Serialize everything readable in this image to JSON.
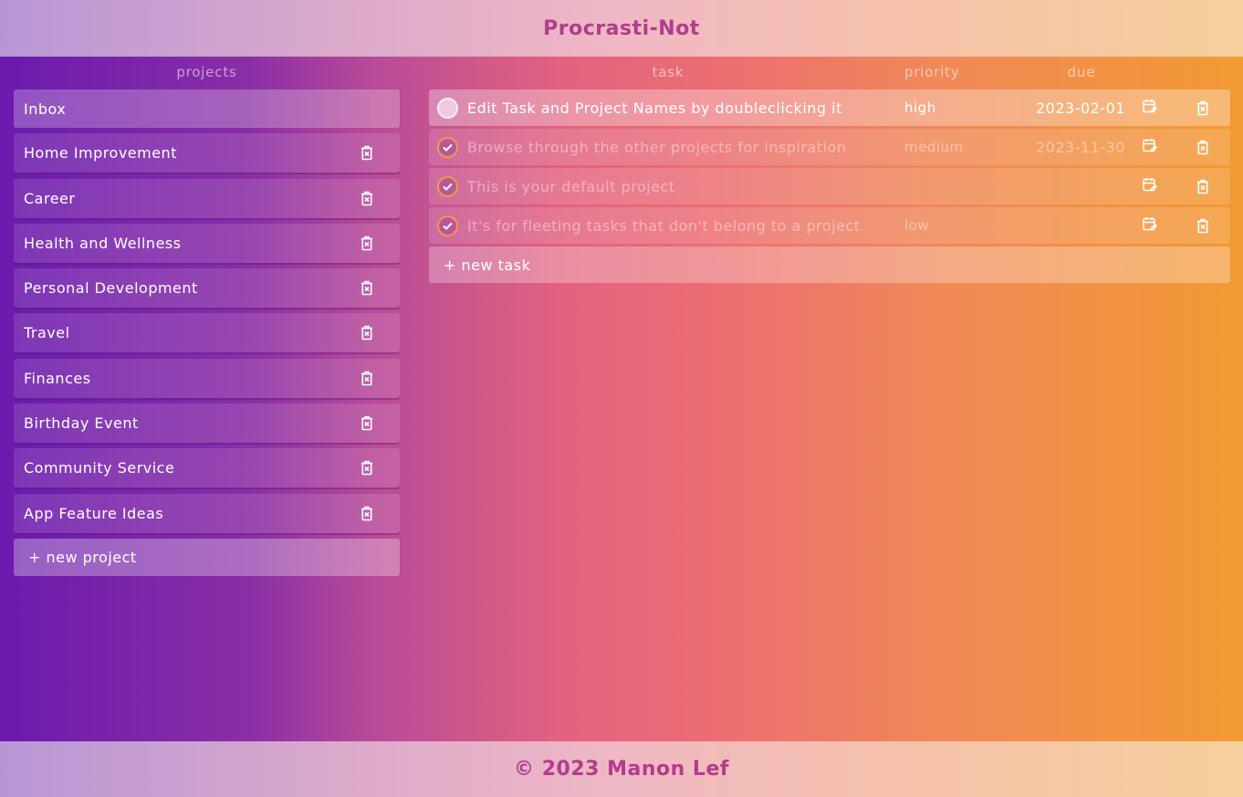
{
  "app": {
    "title": "Procrasti-Not",
    "footer": "© 2023 Manon Lef"
  },
  "columns": {
    "projects": "projects",
    "task": "task",
    "priority": "priority",
    "due": "due"
  },
  "projects": [
    {
      "name": "Inbox",
      "active": true
    },
    {
      "name": "Home Improvement"
    },
    {
      "name": "Career"
    },
    {
      "name": "Health and Wellness"
    },
    {
      "name": "Personal Development"
    },
    {
      "name": "Travel"
    },
    {
      "name": "Finances"
    },
    {
      "name": "Birthday Event"
    },
    {
      "name": "Community Service"
    },
    {
      "name": "App Feature Ideas"
    }
  ],
  "new_project_label": "+ new project",
  "tasks": [
    {
      "name": "Edit Task and Project Names by doubleclicking it",
      "priority": "high",
      "due": "2023-02-01",
      "done": false
    },
    {
      "name": "Browse through the other projects for inspiration",
      "priority": "medium",
      "due": "2023-11-30",
      "done": true
    },
    {
      "name": "This is your default project",
      "priority": "",
      "due": "",
      "done": true
    },
    {
      "name": "It's for fleeting tasks that don't belong to a project",
      "priority": "low",
      "due": "",
      "done": true
    }
  ],
  "new_task_label": "+ new task",
  "icons": {
    "delete": "trash-icon",
    "calendar": "calendar-edit-icon",
    "check": "check-icon"
  }
}
